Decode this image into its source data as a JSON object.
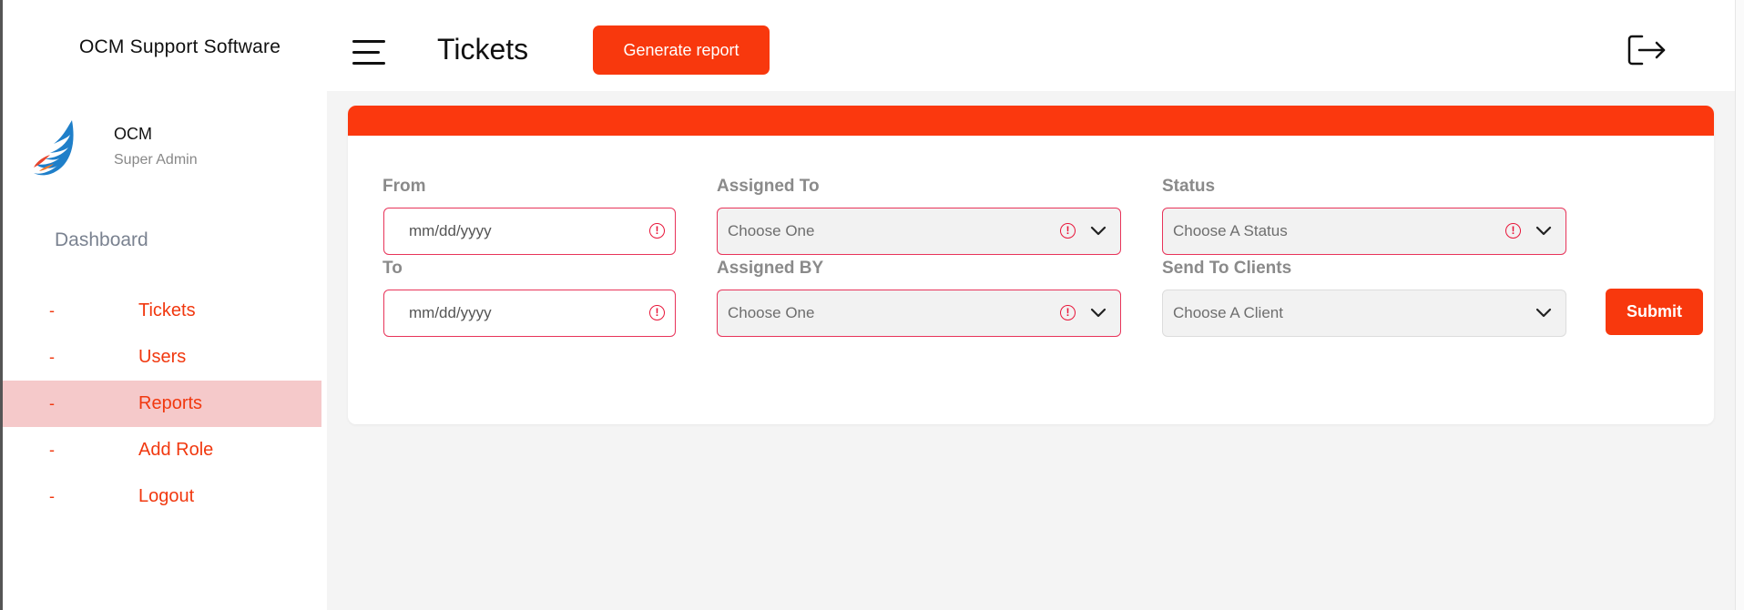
{
  "brand": {
    "title": "OCM Support Software"
  },
  "profile": {
    "name": "OCM",
    "role": "Super Admin"
  },
  "sidebar": {
    "section_title": "Dashboard",
    "items": [
      {
        "mark": "-",
        "label": "Tickets",
        "active": false
      },
      {
        "mark": "-",
        "label": "Users",
        "active": false
      },
      {
        "mark": "-",
        "label": "Reports",
        "active": true
      },
      {
        "mark": "-",
        "label": "Add Role",
        "active": false
      },
      {
        "mark": "-",
        "label": "Logout",
        "active": false
      }
    ]
  },
  "header": {
    "title": "Tickets",
    "generate_button": "Generate report",
    "menu_icon": "hamburger-icon",
    "logout_icon": "logout-icon"
  },
  "filters": {
    "from": {
      "label": "From",
      "placeholder": "mm/dd/yyyy"
    },
    "to": {
      "label": "To",
      "placeholder": "mm/dd/yyyy"
    },
    "assigned_to": {
      "label": "Assigned To",
      "value": "Choose One"
    },
    "assigned_by": {
      "label": "Assigned BY",
      "value": "Choose One"
    },
    "status": {
      "label": "Status",
      "value": "Choose A Status"
    },
    "send_to_clients": {
      "label": "Send To Clients",
      "value": "Choose A Client"
    },
    "submit": "Submit",
    "warning_glyph": "!"
  },
  "colors": {
    "accent": "#f8380d",
    "active_nav_bg": "#f5c9ca",
    "error_border": "#e8345a",
    "nav_text": "#f1380f"
  }
}
